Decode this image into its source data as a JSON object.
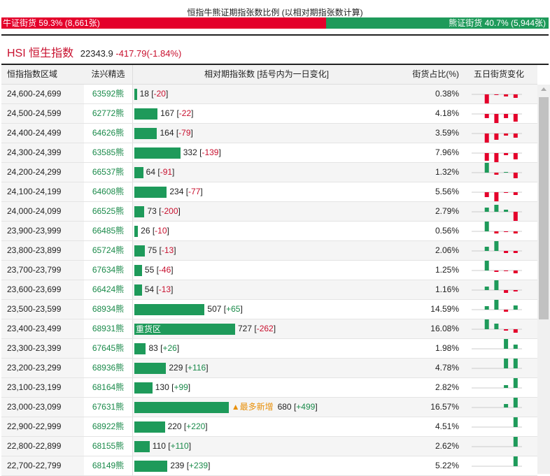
{
  "title": "恒指牛熊证期指张数比例 (以相对期指张数计算)",
  "ratio": {
    "bull_label": "牛证街货 59.3% (8,661张)",
    "bull_pct": 59.3,
    "bear_label": "熊证街货 40.7% (5,944张)",
    "bear_pct": 40.7,
    "bull_color": "#e4002b",
    "bear_color": "#1e9a5a"
  },
  "index": {
    "name": "HSI 恒生指数",
    "value": "22343.9",
    "change": "-417.79(-1.84%)"
  },
  "headers": [
    "恒指指数区域",
    "法兴精选",
    "相对期指张数 [括号内为一日变化]",
    "街货占比(%)",
    "五日街货变化"
  ],
  "rows": [
    {
      "range": "24,600-24,699",
      "code": "63592熊",
      "count": 18,
      "change": "-20",
      "pct": "0.38%",
      "tag": "",
      "five": [
        0,
        -13,
        -1,
        -3,
        -5
      ]
    },
    {
      "range": "24,500-24,599",
      "code": "62772熊",
      "count": 167,
      "change": "-22",
      "pct": "4.18%",
      "tag": "",
      "five": [
        0,
        -6,
        -13,
        -6,
        -11
      ]
    },
    {
      "range": "24,400-24,499",
      "code": "64626熊",
      "count": 164,
      "change": "-79",
      "pct": "3.59%",
      "tag": "",
      "five": [
        0,
        -13,
        -9,
        -3,
        -6
      ]
    },
    {
      "range": "24,300-24,399",
      "code": "63585熊",
      "count": 332,
      "change": "-139",
      "pct": "7.96%",
      "tag": "",
      "five": [
        0,
        -11,
        -13,
        -3,
        -9
      ]
    },
    {
      "range": "24,200-24,299",
      "code": "66537熊",
      "count": 64,
      "change": "-91",
      "pct": "1.32%",
      "tag": "",
      "five": [
        0,
        14,
        -3,
        1,
        -8
      ]
    },
    {
      "range": "24,100-24,199",
      "code": "64608熊",
      "count": 234,
      "change": "-77",
      "pct": "5.56%",
      "tag": "",
      "five": [
        0,
        -7,
        -13,
        -1,
        -4
      ]
    },
    {
      "range": "24,000-24,099",
      "code": "66525熊",
      "count": 73,
      "change": "-200",
      "pct": "2.79%",
      "tag": "",
      "five": [
        0,
        6,
        10,
        3,
        -13
      ]
    },
    {
      "range": "23,900-23,999",
      "code": "66485熊",
      "count": 26,
      "change": "-10",
      "pct": "0.56%",
      "tag": "",
      "five": [
        0,
        14,
        -3,
        -1,
        -3
      ]
    },
    {
      "range": "23,800-23,899",
      "code": "65724熊",
      "count": 75,
      "change": "-13",
      "pct": "2.06%",
      "tag": "",
      "five": [
        0,
        6,
        14,
        -3,
        -3
      ]
    },
    {
      "range": "23,700-23,799",
      "code": "67634熊",
      "count": 55,
      "change": "-46",
      "pct": "1.25%",
      "tag": "",
      "five": [
        0,
        14,
        -2,
        -1,
        -4
      ]
    },
    {
      "range": "23,600-23,699",
      "code": "66424熊",
      "count": 54,
      "change": "-13",
      "pct": "1.16%",
      "tag": "",
      "five": [
        0,
        5,
        14,
        -4,
        -2
      ]
    },
    {
      "range": "23,500-23,599",
      "code": "68934熊",
      "count": 507,
      "change": "+65",
      "pct": "14.59%",
      "tag": "",
      "five": [
        0,
        5,
        14,
        -3,
        6
      ]
    },
    {
      "range": "23,400-23,499",
      "code": "68931熊",
      "count": 727,
      "change": "-262",
      "pct": "16.08%",
      "tag": "重货区",
      "five": [
        0,
        14,
        8,
        -2,
        -5
      ]
    },
    {
      "range": "23,300-23,399",
      "code": "67645熊",
      "count": 83,
      "change": "+26",
      "pct": "1.98%",
      "tag": "",
      "five": [
        0,
        0,
        0,
        14,
        6
      ]
    },
    {
      "range": "23,200-23,299",
      "code": "68936熊",
      "count": 229,
      "change": "+116",
      "pct": "4.78%",
      "tag": "",
      "five": [
        0,
        0,
        0,
        14,
        14
      ]
    },
    {
      "range": "23,100-23,199",
      "code": "68164熊",
      "count": 130,
      "change": "+99",
      "pct": "2.82%",
      "tag": "",
      "five": [
        0,
        0,
        0,
        4,
        14
      ]
    },
    {
      "range": "23,000-23,099",
      "code": "67631熊",
      "count": 680,
      "change": "+499",
      "pct": "16.57%",
      "tag": "",
      "note": "▲最多新增",
      "five": [
        0,
        0,
        0,
        5,
        14
      ]
    },
    {
      "range": "22,900-22,999",
      "code": "68922熊",
      "count": 220,
      "change": "+220",
      "pct": "4.51%",
      "tag": "",
      "five": [
        0,
        0,
        0,
        0,
        14
      ]
    },
    {
      "range": "22,800-22,899",
      "code": "68155熊",
      "count": 110,
      "change": "+110",
      "pct": "2.62%",
      "tag": "",
      "five": [
        0,
        0,
        0,
        0,
        14
      ]
    },
    {
      "range": "22,700-22,799",
      "code": "68149熊",
      "count": 239,
      "change": "+239",
      "pct": "5.22%",
      "tag": "",
      "five": [
        0,
        0,
        0,
        0,
        14
      ]
    }
  ]
}
